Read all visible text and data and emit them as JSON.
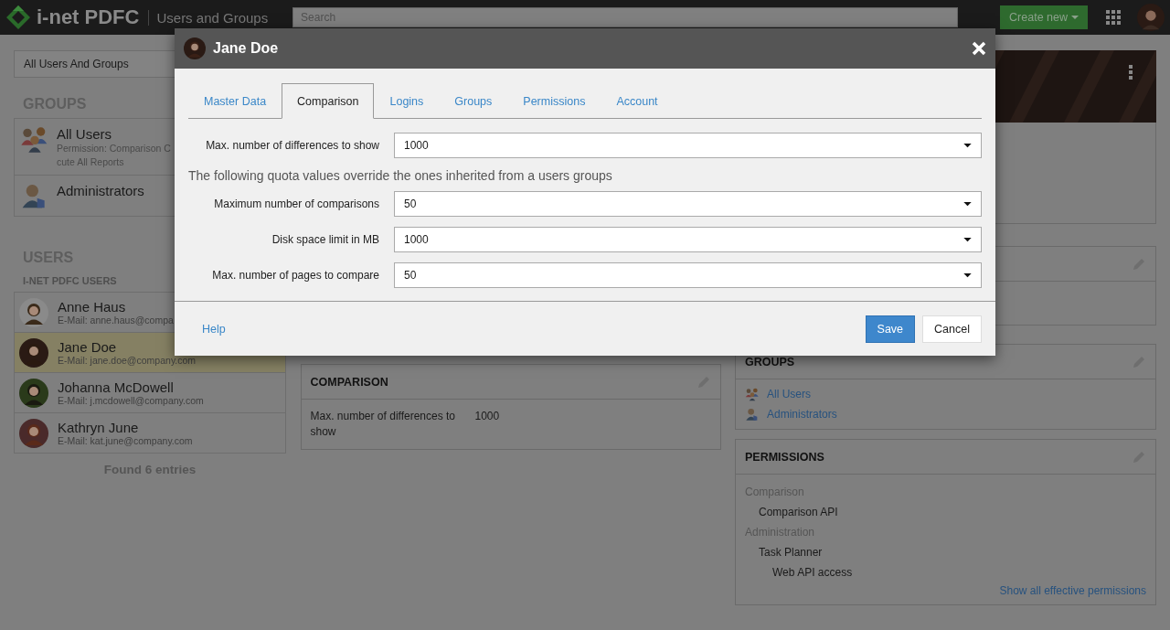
{
  "header": {
    "logo": "i-net PDFC",
    "section": "Users and Groups",
    "search": {
      "placeholder": "Search"
    },
    "create_button": "Create new"
  },
  "filter": {
    "value": "All Users And Groups"
  },
  "groups": {
    "heading": "GROUPS",
    "items": [
      {
        "name": "All Users",
        "details": [
          "Permission: Comparison C",
          "cute All Reports"
        ]
      },
      {
        "name": "Administrators"
      }
    ]
  },
  "users": {
    "heading": "USERS",
    "subheading": "I-NET PDFC USERS",
    "items": [
      {
        "name": "Anne Haus",
        "email": "E-Mail: anne.haus@compa",
        "selected": false
      },
      {
        "name": "Jane Doe",
        "email": "E-Mail: jane.doe@company.com",
        "selected": true
      },
      {
        "name": "Johanna McDowell",
        "email": "E-Mail: j.mcdowell@company.com",
        "selected": false
      },
      {
        "name": "Kathryn June",
        "email": "E-Mail: kat.june@company.com",
        "selected": false
      }
    ],
    "footer": "Found 6 entries"
  },
  "comparison_card": {
    "title": "COMPARISON",
    "rows": [
      {
        "label": "Max. number of differences to show",
        "value": "1000"
      }
    ]
  },
  "groups_card": {
    "title": "GROUPS",
    "links": [
      "All Users",
      "Administrators"
    ]
  },
  "permissions_card": {
    "title": "PERMISSIONS",
    "sections": [
      {
        "heading": "Comparison",
        "children": [
          {
            "label": "Comparison API"
          }
        ]
      },
      {
        "heading": "Administration",
        "children": [
          {
            "label": "Task Planner",
            "children": [
              {
                "label": "Web API access"
              }
            ]
          }
        ]
      }
    ],
    "link": "Show all effective permissions"
  },
  "dialog": {
    "title": "Jane Doe",
    "tabs": [
      {
        "label": "Master Data",
        "selected": false
      },
      {
        "label": "Comparison",
        "selected": true
      },
      {
        "label": "Logins",
        "selected": false
      },
      {
        "label": "Groups",
        "selected": false
      },
      {
        "label": "Permissions",
        "selected": false
      },
      {
        "label": "Account",
        "selected": false
      }
    ],
    "rows": [
      {
        "kind": "select",
        "label": "Max. number of differences to show",
        "value": "1000"
      },
      {
        "kind": "note",
        "text": "The following quota values override the ones inherited from a users groups"
      },
      {
        "kind": "select",
        "label": "Maximum number of comparisons",
        "value": "50"
      },
      {
        "kind": "select",
        "label": "Disk space limit in MB",
        "value": "1000"
      },
      {
        "kind": "select",
        "label": "Max. number of pages to compare",
        "value": "50"
      }
    ],
    "help": "Help",
    "buttons": [
      {
        "label": "Save",
        "kind": "primary"
      },
      {
        "label": "Cancel",
        "kind": "default"
      }
    ]
  }
}
